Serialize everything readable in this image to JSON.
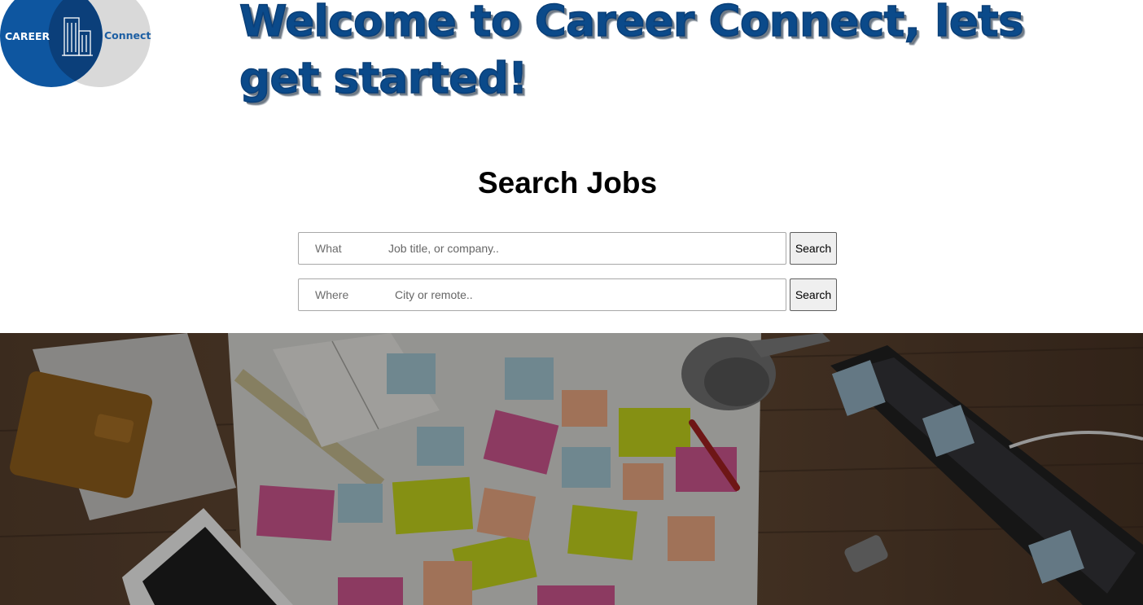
{
  "logo": {
    "left_text": "CAREER",
    "right_text": "Connect"
  },
  "header": {
    "welcome": "Welcome to Career Connect, lets get started!"
  },
  "search": {
    "title": "Search Jobs",
    "what": {
      "label": "What",
      "placeholder": "Job title, or company..",
      "button_label": "Search"
    },
    "where": {
      "label": "Where",
      "placeholder": "City or remote..",
      "button_label": "Search"
    }
  },
  "colors": {
    "brand_blue": "#0b4a8a",
    "logo_grey": "#d9d9d9"
  },
  "icons": {
    "logo": "building-icon"
  }
}
